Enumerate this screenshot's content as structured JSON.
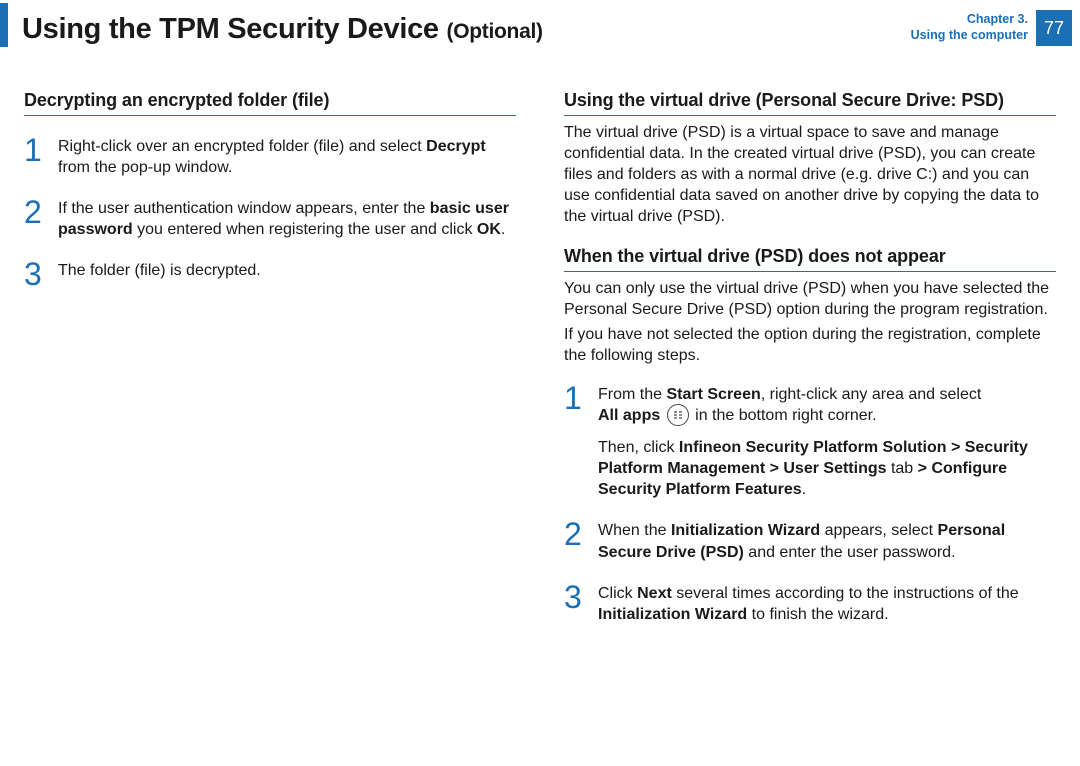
{
  "header": {
    "title_main": "Using the TPM Security Device",
    "title_suffix": "(Optional)",
    "chapter_line1": "Chapter 3.",
    "chapter_line2": "Using the computer",
    "page_number": "77"
  },
  "left": {
    "heading": "Decrypting an encrypted folder (file)",
    "steps": {
      "s1_a": "Right-click over an encrypted folder (file) and select ",
      "s1_b": "Decrypt",
      "s1_c": " from the pop-up window.",
      "s2_a": "If the user authentication window appears, enter the ",
      "s2_b": "basic user password",
      "s2_c": " you entered when registering the user and click ",
      "s2_d": "OK",
      "s2_e": ".",
      "s3": "The folder (file) is decrypted."
    }
  },
  "right": {
    "heading1": "Using the virtual drive (Personal Secure Drive: PSD)",
    "intro": "The virtual drive (PSD) is a virtual space to save and manage confidential data. In the created virtual drive (PSD), you can create files and folders as with a normal drive (e.g. drive C:) and you can use confidential data saved on another drive by copying the data to the virtual drive (PSD).",
    "heading2": "When the virtual drive (PSD) does not appear",
    "para2a": "You can only use the virtual drive (PSD) when you have selected the Personal Secure Drive (PSD) option during the program registration.",
    "para2b": " If you have not selected the option during the registration, complete the following steps.",
    "steps": {
      "s1_a": "From the ",
      "s1_b": "Start Screen",
      "s1_c": ", right-click any area and select ",
      "s1_d": "All apps",
      "s1_e": " in the bottom right corner.",
      "s1_f": "Then, click ",
      "s1_g": "Infineon Security Platform Solution > Security Platform Management > User Settings",
      "s1_h": " tab ",
      "s1_i": "> Configure Security Platform Features",
      "s1_j": ".",
      "s2_a": "When the ",
      "s2_b": "Initialization Wizard",
      "s2_c": " appears, select ",
      "s2_d": "Personal Secure Drive (PSD)",
      "s2_e": " and enter the user password.",
      "s3_a": "Click ",
      "s3_b": "Next",
      "s3_c": " several times according to the instructions of the ",
      "s3_d": "Initialization Wizard",
      "s3_e": " to finish the wizard."
    }
  },
  "nums": {
    "n1": "1",
    "n2": "2",
    "n3": "3"
  }
}
